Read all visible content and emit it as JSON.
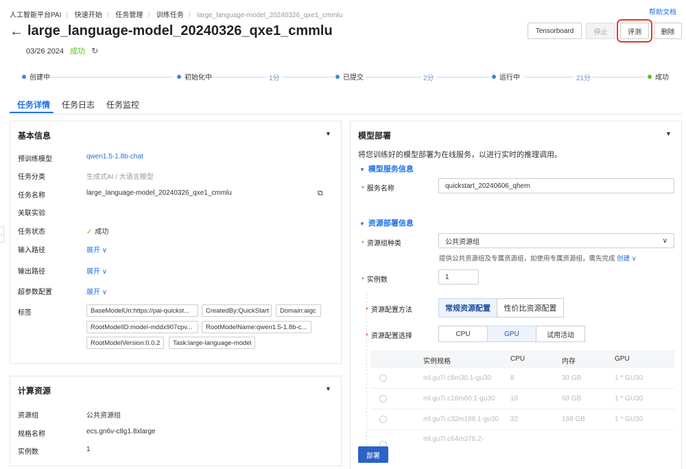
{
  "breadcrumb": [
    "人工智能平台PAI",
    "快速开始",
    "任务管理",
    "训练任务",
    "large_language-model_20240326_qxe1_cmmlu"
  ],
  "help_link": "帮助文档",
  "page": {
    "title": "large_language-model_20240326_qxe1_cmmlu",
    "date": "03/26 2024",
    "status": "成功"
  },
  "actions": {
    "tensorboard": "Tensorboard",
    "stop": "停止",
    "evaluate": "评测",
    "delete": "删除"
  },
  "steps": [
    {
      "label": "创建中"
    },
    {
      "label": "初始化中"
    },
    {
      "label": "已提交"
    },
    {
      "label": "运行中"
    },
    {
      "label": "成功"
    }
  ],
  "durations": [
    "1分",
    "2分",
    "21分"
  ],
  "tabs": [
    "任务详情",
    "任务日志",
    "任务监控"
  ],
  "basic_info": {
    "title": "基本信息",
    "rows": {
      "pretrained_model": {
        "label": "预训练模型",
        "value": "qwen1.5-1.8b-chat"
      },
      "category": {
        "label": "任务分类",
        "value": "生成式AI",
        "value2": "大语言模型"
      },
      "task_name": {
        "label": "任务名称",
        "value": "large_language-model_20240326_qxe1_cmmlu"
      },
      "related_exp": {
        "label": "关联实验"
      },
      "task_status": {
        "label": "任务状态",
        "value": "成功"
      },
      "input_path": {
        "label": "输入路径",
        "value": "展开"
      },
      "output_path": {
        "label": "输出路径",
        "value": "展开"
      },
      "hyperparams": {
        "label": "超参数配置",
        "value": "展开"
      },
      "tags_label": {
        "label": "标签"
      }
    },
    "tags": [
      "BaseModelUri:https://pai-quickst...",
      "CreatedBy:QuickStart",
      "Domain:aigc",
      "RootModelID:model-mddx907cpv...",
      "RootModelName:qwen1.5-1.8b-c...",
      "RootModelVersion:0.0.2",
      "Task:large-language-model"
    ]
  },
  "compute": {
    "title": "计算资源",
    "resource_group": {
      "label": "资源组",
      "value": "公共资源组"
    },
    "spec": {
      "label": "规格名称",
      "value": "ecs.gn6v-c8g1.8xlarge"
    },
    "instances": {
      "label": "实例数",
      "value": "1"
    }
  },
  "deploy": {
    "title": "模型部署",
    "desc": "将您训练好的模型部署为在线服务，以进行实时的推理调用。",
    "service_section": "模型服务信息",
    "service_name": {
      "label": "服务名称",
      "value": "quickstart_20240606_qhem"
    },
    "resource_section": "资源部署信息",
    "resource_type": {
      "label": "资源组种类",
      "value": "公共资源组"
    },
    "hint": "提供公共资源组及专属资源组，如使用专属资源组，需先完成",
    "create_link": "创建",
    "instance_count": {
      "label": "实例数",
      "value": "1"
    },
    "config_method": {
      "label": "资源配置方法",
      "options": [
        "常规资源配置",
        "性价比资源配置"
      ],
      "selected": "常规资源配置"
    },
    "config_choice": {
      "label": "资源配置选择",
      "options": [
        "CPU",
        "GPU",
        "试用活动"
      ],
      "selected": "GPU"
    },
    "table": {
      "headers": [
        "实例规格",
        "CPU",
        "内存",
        "GPU"
      ],
      "rows": [
        [
          "ml.gu7i.c8m30.1-gu30",
          "8",
          "30 GB",
          "1 * GU30"
        ],
        [
          "ml.gu7i.c16m60.1-gu30",
          "16",
          "60 GB",
          "1 * GU30"
        ],
        [
          "ml.gu7i.c32m188.1-gu30",
          "32",
          "188 GB",
          "1 * GU30"
        ],
        [
          "ml.gu7i.c64m376.2-",
          "",
          "",
          ""
        ]
      ]
    },
    "submit": "部署"
  }
}
